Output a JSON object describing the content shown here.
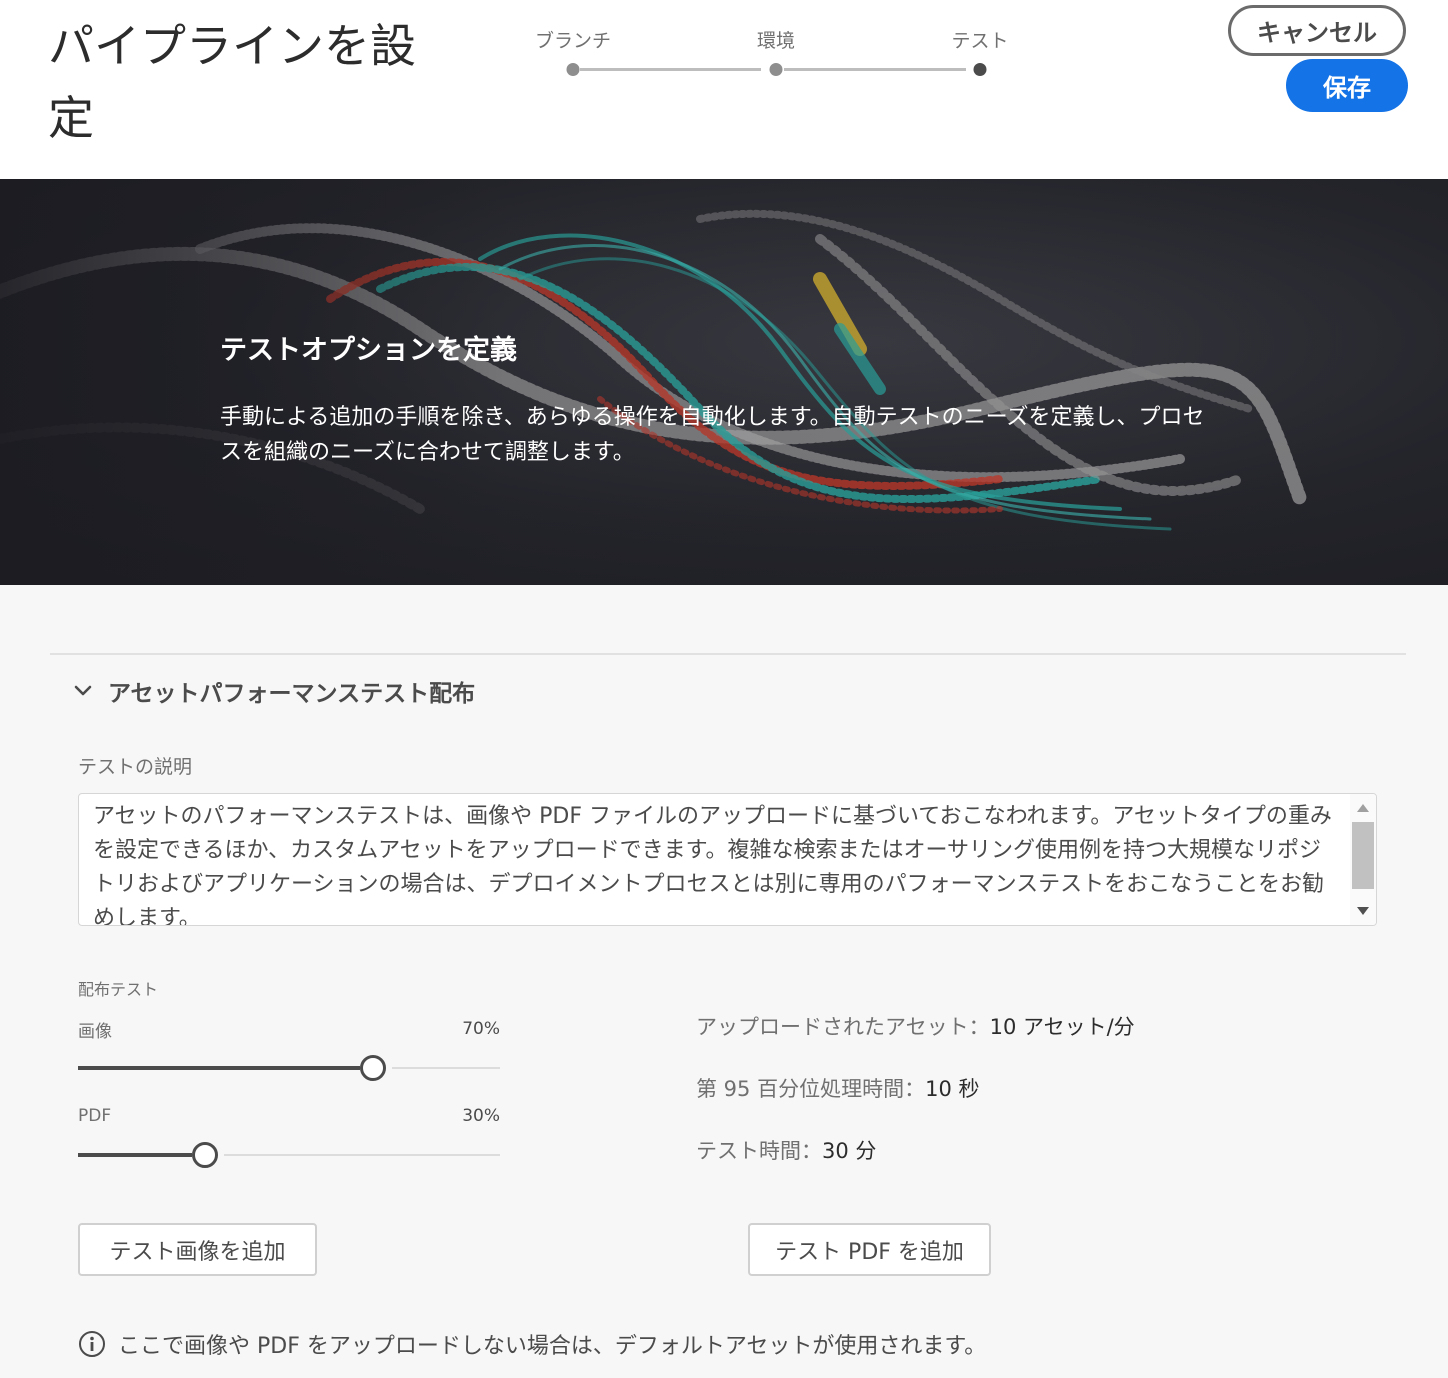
{
  "header": {
    "title": "パイプラインを設定",
    "steps": [
      {
        "label": "ブランチ"
      },
      {
        "label": "環境"
      },
      {
        "label": "テスト"
      }
    ],
    "active_step": 3,
    "cancel_label": "キャンセル",
    "save_label": "保存"
  },
  "hero": {
    "title": "テストオプションを定義",
    "text": "手動による追加の手順を除き、あらゆる操作を自動化します。自動テストのニーズを定義し、プロセスを組織のニーズに合わせて調整します。"
  },
  "section": {
    "title": "アセットパフォーマンステスト配布",
    "description_label": "テストの説明",
    "description": "アセットのパフォーマンステストは、画像や PDF ファイルのアップロードに基づいておこなわれます。アセットタイプの重みを設定できるほか、カスタムアセットをアップロードできます。複雑な検索またはオーサリング使用例を持つ大規模なリポジトリおよびアプリケーションの場合は、デプロイメントプロセスとは別に専用のパフォーマンステストをおこなうことをお勧めします。",
    "distribution_label": "配布テスト",
    "sliders": [
      {
        "label": "画像",
        "value_text": "70%",
        "value": 70
      },
      {
        "label": "PDF",
        "value_text": "30%",
        "value": 30
      }
    ],
    "stats": [
      {
        "label": "アップロードされたアセット：",
        "value": "10 アセット/分"
      },
      {
        "label": "第 95 百分位処理時間：",
        "value": "10 秒"
      },
      {
        "label": "テスト時間：",
        "value": "30 分"
      }
    ],
    "add_image_label": "テスト画像を追加",
    "add_pdf_label": "テスト PDF を追加",
    "info_text": "ここで画像や PDF をアップロードしない場合は、デフォルトアセットが使用されます。"
  },
  "colors": {
    "accent": "#1473e6",
    "hero_bg": "#24242b",
    "page_bg": "#f7f7f7"
  }
}
